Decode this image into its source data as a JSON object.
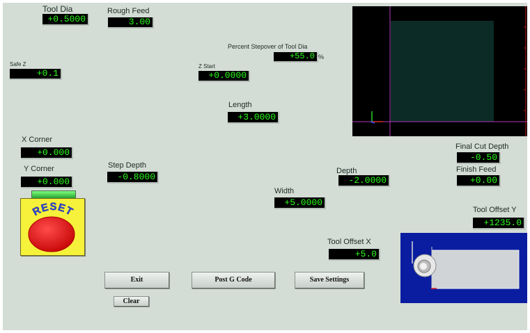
{
  "fields": {
    "tool_dia": {
      "label": "Tool Dia",
      "value": "+0.5000"
    },
    "rough_feed": {
      "label": "Rough Feed",
      "value": "3.00"
    },
    "safe_z": {
      "label": "Safe Z",
      "value": "+0.1"
    },
    "percent_stepover": {
      "label": "Percent Stepover of Tool Dia",
      "value": "+55.0",
      "unit": "%"
    },
    "z_start": {
      "label": "Z Start",
      "value": "+0.0000"
    },
    "length": {
      "label": "Length",
      "value": "+3.0000"
    },
    "x_corner": {
      "label": "X Corner",
      "value": "+0.000"
    },
    "y_corner": {
      "label": "Y Corner",
      "value": "+0.000"
    },
    "step_depth": {
      "label": "Step Depth",
      "value": "-0.8000"
    },
    "depth": {
      "label": "Depth",
      "value": "-2.0000"
    },
    "width": {
      "label": "Width",
      "value": "+5.0000"
    },
    "final_cut_depth": {
      "label": "Final Cut Depth",
      "value": "-0.50"
    },
    "finish_feed": {
      "label": "Finish Feed",
      "value": "+0.00"
    },
    "tool_offset_y": {
      "label": "Tool Offset Y",
      "value": "+1235.0"
    },
    "tool_offset_x": {
      "label": "Tool Offset X",
      "value": "+5.0"
    }
  },
  "reset": {
    "label": "RESET"
  },
  "buttons": {
    "exit": "Exit",
    "post_g_code": "Post G Code",
    "save_settings": "Save Settings",
    "clear": "Clear"
  },
  "colors": {
    "background": "#d3dcd5",
    "dro_text": "#2cff1c",
    "dro_background": "#000000",
    "toolpath_panel": "#0a1da0",
    "reset_button": "#e10b0b",
    "reset_plate": "#f6f13a"
  }
}
